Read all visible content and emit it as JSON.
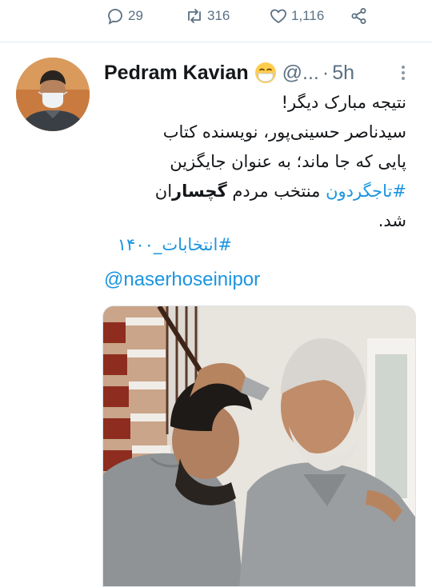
{
  "actions": {
    "reply_count": "29",
    "retweet_count": "316",
    "like_count": "1,116"
  },
  "tweet": {
    "author_name": "Pedram Kavian",
    "author_emoji": "mask-face-emoji",
    "handle": "@...",
    "separator": "·",
    "time": "5h",
    "text_lines": [
      "نتیجه مبارک دیگر!",
      "سیدناصر حسینی‌پور، نویسنده کتاب",
      "پایی که جا ماند؛ به عنوان جایگزین",
      "منتخب مردم",
      "ان",
      "شد."
    ],
    "hashtag_tajgardun": "#تاجگردون",
    "bold_word": "گچسار",
    "hashtag_elections": "#انتخابات_۱۴۰۰",
    "mention": "@naserhoseinipor"
  },
  "icons": {
    "reply": "reply-icon",
    "retweet": "retweet-icon",
    "like": "heart-icon",
    "share": "share-icon",
    "more": "more-vertical-icon"
  },
  "colors": {
    "link": "#1b95e0",
    "muted": "#5b7083",
    "text": "#14171a"
  }
}
